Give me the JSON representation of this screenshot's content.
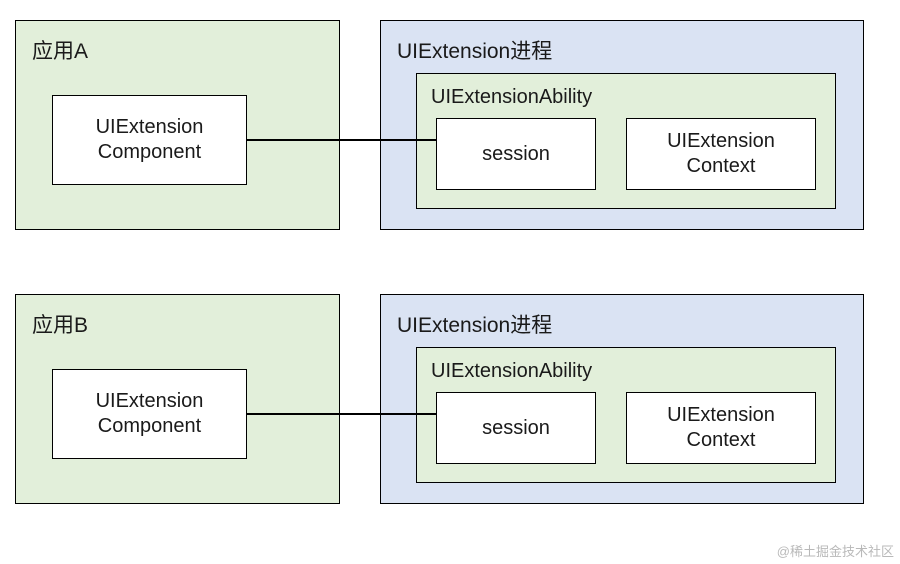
{
  "group1": {
    "app": {
      "title": "应用A",
      "component": "UIExtension\nComponent"
    },
    "process": {
      "title": "UIExtension进程",
      "ability": {
        "title": "UIExtensionAbility",
        "session": "session",
        "context": "UIExtension\nContext"
      }
    }
  },
  "group2": {
    "app": {
      "title": "应用B",
      "component": "UIExtension\nComponent"
    },
    "process": {
      "title": "UIExtension进程",
      "ability": {
        "title": "UIExtensionAbility",
        "session": "session",
        "context": "UIExtension\nContext"
      }
    }
  },
  "watermark": "@稀土掘金技术社区"
}
